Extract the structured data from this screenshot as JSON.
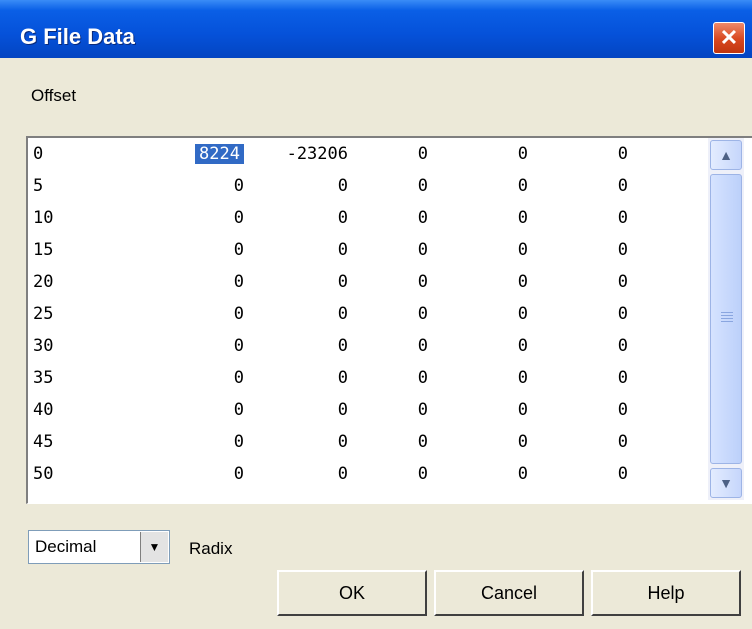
{
  "window": {
    "title": "G File Data",
    "close_icon": "✕"
  },
  "offset_label": "Offset",
  "grid": {
    "rows": [
      {
        "offset": "0",
        "values": [
          "8224",
          "-23206",
          "0",
          "0",
          "0"
        ],
        "selected_col": 0
      },
      {
        "offset": "5",
        "values": [
          "0",
          "0",
          "0",
          "0",
          "0"
        ]
      },
      {
        "offset": "10",
        "values": [
          "0",
          "0",
          "0",
          "0",
          "0"
        ]
      },
      {
        "offset": "15",
        "values": [
          "0",
          "0",
          "0",
          "0",
          "0"
        ]
      },
      {
        "offset": "20",
        "values": [
          "0",
          "0",
          "0",
          "0",
          "0"
        ]
      },
      {
        "offset": "25",
        "values": [
          "0",
          "0",
          "0",
          "0",
          "0"
        ]
      },
      {
        "offset": "30",
        "values": [
          "0",
          "0",
          "0",
          "0",
          "0"
        ]
      },
      {
        "offset": "35",
        "values": [
          "0",
          "0",
          "0",
          "0",
          "0"
        ]
      },
      {
        "offset": "40",
        "values": [
          "0",
          "0",
          "0",
          "0",
          "0"
        ]
      },
      {
        "offset": "45",
        "values": [
          "0",
          "0",
          "0",
          "0",
          "0"
        ]
      },
      {
        "offset": "50",
        "values": [
          "0",
          "0",
          "0",
          "0",
          "0"
        ]
      }
    ]
  },
  "scrollbar": {
    "up_icon": "▲",
    "down_icon": "▼"
  },
  "radix": {
    "value": "Decimal",
    "label": "Radix",
    "arrow_icon": "▼"
  },
  "buttons": {
    "ok": "OK",
    "cancel": "Cancel",
    "help": "Help"
  },
  "colors": {
    "titlebar": "#0551d9",
    "selection": "#316ac5",
    "face": "#ece9d8"
  }
}
